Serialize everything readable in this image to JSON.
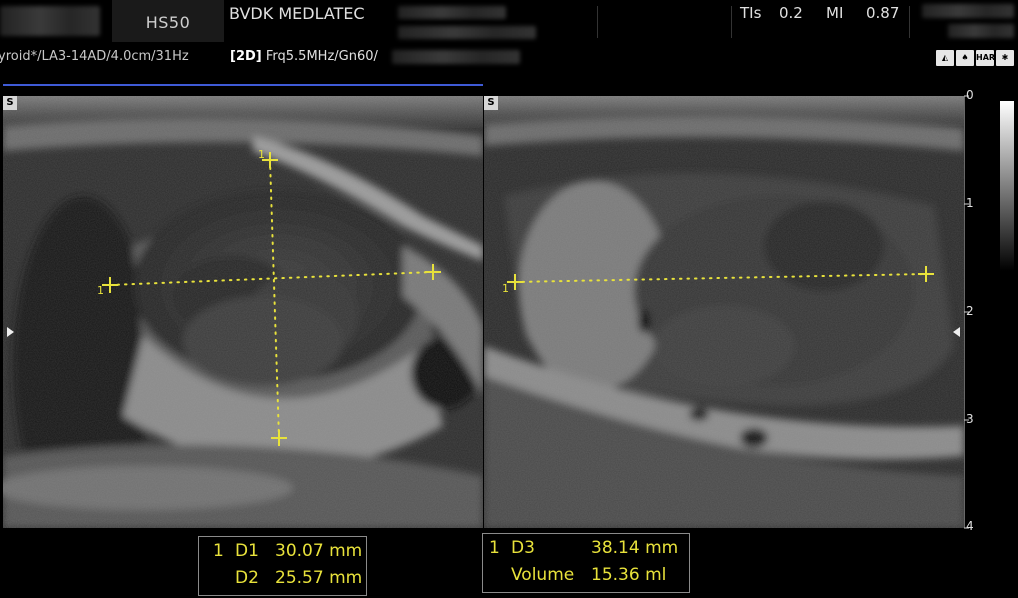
{
  "header": {
    "model": "HS50",
    "hospital": "BVDK MEDLATEC",
    "ti_label": "TIs",
    "ti_value": "0.2",
    "mi_label": "MI",
    "mi_value": "0.87"
  },
  "status": {
    "preset": "yroid*/LA3-14AD/4.0cm/31Hz",
    "mode_badge": "[2D]",
    "mode_params": "Frq5.5MHz/Gn60/"
  },
  "toolbar_icons": [
    {
      "name": "probe-orientation-icon",
      "glyph": "◭"
    },
    {
      "name": "body-marker-icon",
      "glyph": "♠"
    },
    {
      "name": "harmonic-icon",
      "glyph": "HAR"
    },
    {
      "name": "settings-gear-icon",
      "glyph": "✱"
    }
  ],
  "panes": {
    "left_marker": "S",
    "right_marker": "S"
  },
  "depth_scale": {
    "unit_labels": [
      "0",
      "1",
      "2",
      "3",
      "4"
    ]
  },
  "calipers": {
    "left_index": "1",
    "right_index": "1"
  },
  "measurements": {
    "left": [
      {
        "index": "1",
        "label": "D1",
        "value": "30.07 mm"
      },
      {
        "index": "",
        "label": "D2",
        "value": "25.57 mm"
      }
    ],
    "right": [
      {
        "index": "1",
        "label": "D3",
        "value": "38.14 mm"
      },
      {
        "index": "",
        "label": "Volume",
        "value": "15.36 ml"
      }
    ]
  },
  "colors": {
    "caliper": "#e8e23b",
    "active_frame": "#3f5bd6"
  }
}
